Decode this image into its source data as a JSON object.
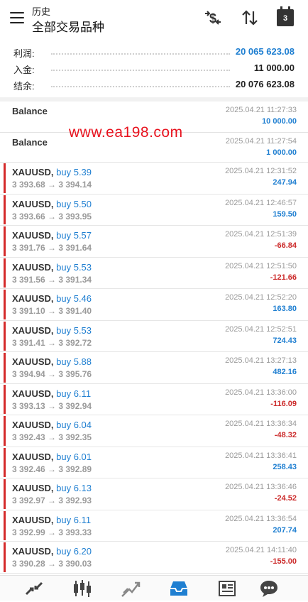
{
  "header": {
    "subtitle": "历史",
    "title": "全部交易品种",
    "calendar_day": "3"
  },
  "summary": [
    {
      "label": "利润:",
      "value": "20 065 623.08",
      "style": "blue"
    },
    {
      "label": "入金:",
      "value": "11 000.00",
      "style": "bold"
    },
    {
      "label": "结余:",
      "value": "20 076 623.08",
      "style": "bold"
    }
  ],
  "balances": [
    {
      "name": "Balance",
      "time": "2025.04.21 11:27:33",
      "amount": "10 000.00"
    },
    {
      "name": "Balance",
      "time": "2025.04.21 11:27:54",
      "amount": "1 000.00"
    }
  ],
  "watermark": "www.ea198.com",
  "trades": [
    {
      "symbol": "XAUUSD,",
      "dir": "buy 5.39",
      "prices": "3 393.68 → 3 394.14",
      "time": "2025.04.21 12:31:52",
      "profit": "247.94",
      "sign": "pos"
    },
    {
      "symbol": "XAUUSD,",
      "dir": "buy 5.50",
      "prices": "3 393.66 → 3 393.95",
      "time": "2025.04.21 12:46:57",
      "profit": "159.50",
      "sign": "pos"
    },
    {
      "symbol": "XAUUSD,",
      "dir": "buy 5.57",
      "prices": "3 391.76 → 3 391.64",
      "time": "2025.04.21 12:51:39",
      "profit": "-66.84",
      "sign": "neg"
    },
    {
      "symbol": "XAUUSD,",
      "dir": "buy 5.53",
      "prices": "3 391.56 → 3 391.34",
      "time": "2025.04.21 12:51:50",
      "profit": "-121.66",
      "sign": "neg"
    },
    {
      "symbol": "XAUUSD,",
      "dir": "buy 5.46",
      "prices": "3 391.10 → 3 391.40",
      "time": "2025.04.21 12:52:20",
      "profit": "163.80",
      "sign": "pos"
    },
    {
      "symbol": "XAUUSD,",
      "dir": "buy 5.53",
      "prices": "3 391.41 → 3 392.72",
      "time": "2025.04.21 12:52:51",
      "profit": "724.43",
      "sign": "pos"
    },
    {
      "symbol": "XAUUSD,",
      "dir": "buy 5.88",
      "prices": "3 394.94 → 3 395.76",
      "time": "2025.04.21 13:27:13",
      "profit": "482.16",
      "sign": "pos"
    },
    {
      "symbol": "XAUUSD,",
      "dir": "buy 6.11",
      "prices": "3 393.13 → 3 392.94",
      "time": "2025.04.21 13:36:00",
      "profit": "-116.09",
      "sign": "neg"
    },
    {
      "symbol": "XAUUSD,",
      "dir": "buy 6.04",
      "prices": "3 392.43 → 3 392.35",
      "time": "2025.04.21 13:36:34",
      "profit": "-48.32",
      "sign": "neg"
    },
    {
      "symbol": "XAUUSD,",
      "dir": "buy 6.01",
      "prices": "3 392.46 → 3 392.89",
      "time": "2025.04.21 13:36:41",
      "profit": "258.43",
      "sign": "pos"
    },
    {
      "symbol": "XAUUSD,",
      "dir": "buy 6.13",
      "prices": "3 392.97 → 3 392.93",
      "time": "2025.04.21 13:36:46",
      "profit": "-24.52",
      "sign": "neg"
    },
    {
      "symbol": "XAUUSD,",
      "dir": "buy 6.11",
      "prices": "3 392.99 → 3 393.33",
      "time": "2025.04.21 13:36:54",
      "profit": "207.74",
      "sign": "pos"
    },
    {
      "symbol": "XAUUSD,",
      "dir": "buy 6.20",
      "prices": "3 390.28 → 3 390.03",
      "time": "2025.04.21 14:11:40",
      "profit": "-155.00",
      "sign": "neg"
    }
  ],
  "nav": [
    "quotes-icon",
    "chart-icon",
    "trade-icon",
    "history-icon",
    "news-icon",
    "chat-icon"
  ],
  "colors": {
    "accent": "#1f7fd1",
    "loss": "#cc2b2b",
    "trade_bar": "#d42a2a",
    "watermark": "#e8121e"
  }
}
